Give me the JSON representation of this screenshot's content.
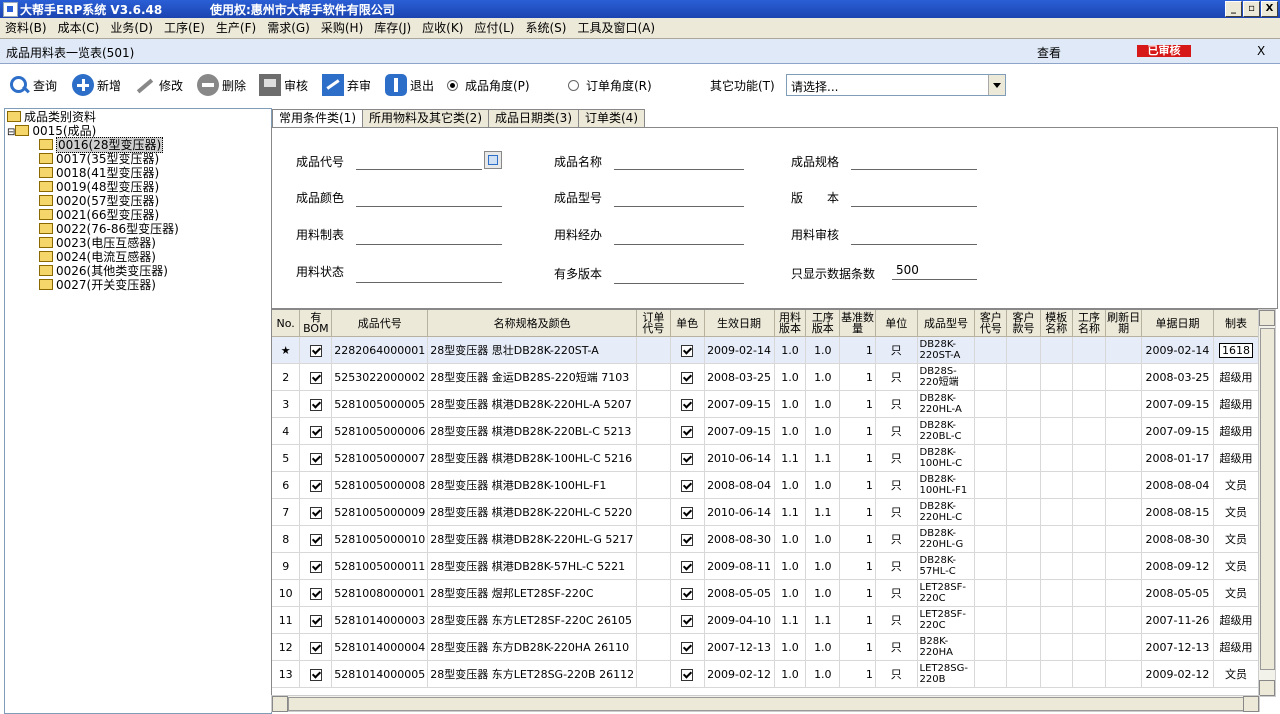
{
  "window": {
    "title": "大帮手ERP系统 V3.6.48",
    "license": "使用权:惠州市大帮手软件有限公司",
    "controls": [
      "_",
      "▫",
      "X"
    ]
  },
  "menu": [
    "资料(B)",
    "成本(C)",
    "业务(D)",
    "工序(E)",
    "生产(F)",
    "需求(G)",
    "采购(H)",
    "库存(J)",
    "应收(K)",
    "应付(L)",
    "系统(S)",
    "工具及窗口(A)"
  ],
  "docbar": {
    "title": "成品用料表一览表(501)",
    "mode": "查看",
    "stamp": "已审核",
    "close": "X"
  },
  "toolbar": {
    "search": "查询",
    "add": "新增",
    "edit": "修改",
    "delete": "删除",
    "audit": "审核",
    "unaudit": "弃审",
    "exit": "退出",
    "radio_product": "成品角度(P)",
    "radio_order": "订单角度(R)",
    "other_label": "其它功能(T)",
    "other_value": "请选择..."
  },
  "tree": {
    "root": "成品类别资料",
    "group": "0015(成品)",
    "items": [
      "0016(28型变压器)",
      "0017(35型变压器)",
      "0018(41型变压器)",
      "0019(48型变压器)",
      "0020(57型变压器)",
      "0021(66型变压器)",
      "0022(76-86型变压器)",
      "0023(电压互感器)",
      "0024(电流互感器)",
      "0026(其他类变压器)",
      "0027(开关变压器)"
    ]
  },
  "tabs": [
    "常用条件类(1)",
    "所用物料及其它类(2)",
    "成品日期类(3)",
    "订单类(4)"
  ],
  "form": {
    "code": "成品代号",
    "name": "成品名称",
    "spec": "成品规格",
    "color": "成品颜色",
    "model": "成品型号",
    "version": "版　　本",
    "maker": "用料制表",
    "handler": "用料经办",
    "auditor": "用料审核",
    "status": "用料状态",
    "multi": "有多版本",
    "limit_label": "只显示数据条数",
    "limit_value": "500"
  },
  "grid": {
    "headers": [
      "No.",
      "有BOM",
      "成品代号",
      "名称规格及颜色",
      "订单代号",
      "单色",
      "生效日期",
      "用料版本",
      "工序版本",
      "基准数量",
      "单位",
      "成品型号",
      "客户代号",
      "客户款号",
      "模板名称",
      "工序名称",
      "刷新日期",
      "单据日期",
      "制表"
    ],
    "rows": [
      {
        "no": "★",
        "code": "2282064000001",
        "name": "28型变压器 思壮DB28K-220ST-A",
        "date": "2009-02-14",
        "mver": "1.0",
        "pver": "1.0",
        "qty": "1",
        "unit": "只",
        "model": "DB28K-220ST-A",
        "bill": "2009-02-14",
        "maker": "1618"
      },
      {
        "no": "2",
        "code": "5253022000002",
        "name": "28型变压器 金运DB28S-220短端 7103",
        "date": "2008-03-25",
        "mver": "1.0",
        "pver": "1.0",
        "qty": "1",
        "unit": "只",
        "model": "DB28S-220短端",
        "bill": "2008-03-25",
        "maker": "超级用"
      },
      {
        "no": "3",
        "code": "5281005000005",
        "name": "28型变压器 棋港DB28K-220HL-A 5207",
        "date": "2007-09-15",
        "mver": "1.0",
        "pver": "1.0",
        "qty": "1",
        "unit": "只",
        "model": "DB28K-220HL-A",
        "bill": "2007-09-15",
        "maker": "超级用"
      },
      {
        "no": "4",
        "code": "5281005000006",
        "name": "28型变压器 棋港DB28K-220BL-C 5213",
        "date": "2007-09-15",
        "mver": "1.0",
        "pver": "1.0",
        "qty": "1",
        "unit": "只",
        "model": "DB28K-220BL-C",
        "bill": "2007-09-15",
        "maker": "超级用"
      },
      {
        "no": "5",
        "code": "5281005000007",
        "name": "28型变压器 棋港DB28K-100HL-C 5216",
        "date": "2010-06-14",
        "mver": "1.1",
        "pver": "1.1",
        "qty": "1",
        "unit": "只",
        "model": "DB28K-100HL-C",
        "bill": "2008-01-17",
        "maker": "超级用"
      },
      {
        "no": "6",
        "code": "5281005000008",
        "name": "28型变压器 棋港DB28K-100HL-F1",
        "date": "2008-08-04",
        "mver": "1.0",
        "pver": "1.0",
        "qty": "1",
        "unit": "只",
        "model": "DB28K-100HL-F1",
        "bill": "2008-08-04",
        "maker": "文员"
      },
      {
        "no": "7",
        "code": "5281005000009",
        "name": "28型变压器 棋港DB28K-220HL-C 5220",
        "date": "2010-06-14",
        "mver": "1.1",
        "pver": "1.1",
        "qty": "1",
        "unit": "只",
        "model": "DB28K-220HL-C",
        "bill": "2008-08-15",
        "maker": "文员"
      },
      {
        "no": "8",
        "code": "5281005000010",
        "name": "28型变压器 棋港DB28K-220HL-G 5217",
        "date": "2008-08-30",
        "mver": "1.0",
        "pver": "1.0",
        "qty": "1",
        "unit": "只",
        "model": "DB28K-220HL-G",
        "bill": "2008-08-30",
        "maker": "文员"
      },
      {
        "no": "9",
        "code": "5281005000011",
        "name": "28型变压器 棋港DB28K-57HL-C 5221",
        "date": "2009-08-11",
        "mver": "1.0",
        "pver": "1.0",
        "qty": "1",
        "unit": "只",
        "model": "DB28K-57HL-C",
        "bill": "2008-09-12",
        "maker": "文员"
      },
      {
        "no": "10",
        "code": "5281008000001",
        "name": "28型变压器 煜邦LET28SF-220C",
        "date": "2008-05-05",
        "mver": "1.0",
        "pver": "1.0",
        "qty": "1",
        "unit": "只",
        "model": "LET28SF-220C",
        "bill": "2008-05-05",
        "maker": "文员"
      },
      {
        "no": "11",
        "code": "5281014000003",
        "name": "28型变压器 东方LET28SF-220C 26105",
        "date": "2009-04-10",
        "mver": "1.1",
        "pver": "1.1",
        "qty": "1",
        "unit": "只",
        "model": "LET28SF-220C",
        "bill": "2007-11-26",
        "maker": "超级用"
      },
      {
        "no": "12",
        "code": "5281014000004",
        "name": "28型变压器 东方DB28K-220HA 26110",
        "date": "2007-12-13",
        "mver": "1.0",
        "pver": "1.0",
        "qty": "1",
        "unit": "只",
        "model": "B28K-220HA",
        "bill": "2007-12-13",
        "maker": "超级用"
      },
      {
        "no": "13",
        "code": "5281014000005",
        "name": "28型变压器 东方LET28SG-220B 26112",
        "date": "2009-02-12",
        "mver": "1.0",
        "pver": "1.0",
        "qty": "1",
        "unit": "只",
        "model": "LET28SG-220B",
        "bill": "2009-02-12",
        "maker": "文员"
      }
    ]
  }
}
